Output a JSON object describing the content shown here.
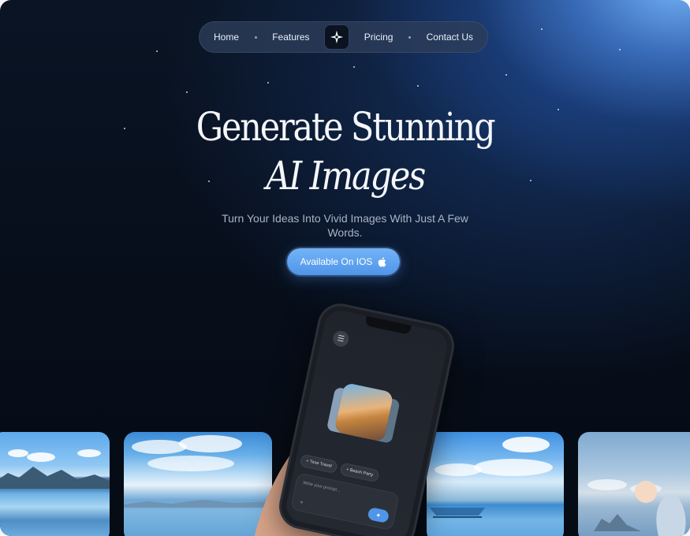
{
  "nav": {
    "items": [
      {
        "label": "Home"
      },
      {
        "label": "Features"
      },
      {
        "label": "Pricing"
      },
      {
        "label": "Contact Us"
      }
    ],
    "logo_icon": "sparkle-icon"
  },
  "hero": {
    "title_line1": "Generate Stunning",
    "title_line2": "AI Images",
    "subtitle": "Turn Your Ideas Into Vivid Images With Just A Few Words.",
    "cta_label": "Available On IOS",
    "cta_icon": "apple-icon"
  },
  "phone": {
    "menu_icon": "menu-icon",
    "chips": [
      "Time Travel",
      "Beach Party"
    ],
    "prompt_placeholder": "Write your prompt...",
    "prompt_icon": "attach-icon",
    "send_icon": "sparkle-icon"
  },
  "colors": {
    "accent": "#4f95e8",
    "background": "#070e1a",
    "glow": "#78b9ff"
  }
}
